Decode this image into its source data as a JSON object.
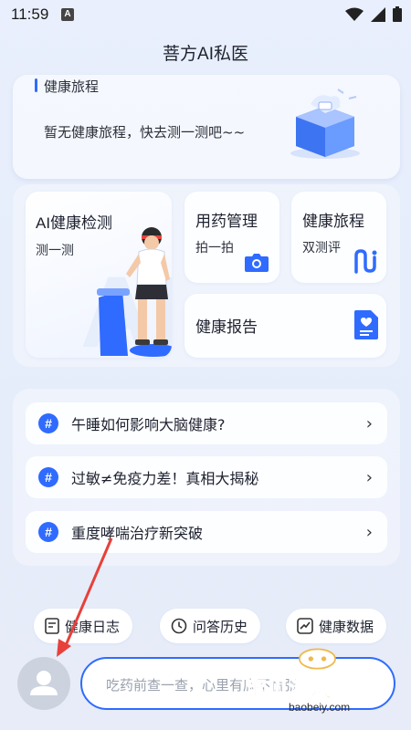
{
  "status_bar": {
    "time": "11:59",
    "notif_letter": "A"
  },
  "header": {
    "title": "菩方AI私医"
  },
  "journey": {
    "title": "健康旅程",
    "empty_text": "暂无健康旅程，快去测一测吧~~"
  },
  "features": {
    "ai_check": {
      "title": "AI健康检测",
      "sub": "测一测"
    },
    "medicine": {
      "title": "用药管理",
      "sub": "拍一拍"
    },
    "journey": {
      "title": "健康旅程",
      "sub": "双测评"
    },
    "report": {
      "title": "健康报告"
    }
  },
  "questions": [
    {
      "text": "午睡如何影响大脑健康?"
    },
    {
      "text": "过敏≠免疫力差！真相大揭秘"
    },
    {
      "text": "重度哮喘治疗新突破"
    }
  ],
  "chips": {
    "diary": "健康日志",
    "history": "问答历史",
    "data": "健康数据"
  },
  "input": {
    "placeholder": "吃药前查一查，心里有底不慌张"
  },
  "watermark": {
    "text": "宝贝游戏网",
    "url": "baobeiy.com"
  },
  "colors": {
    "accent": "#2f6bff",
    "background": "#e8eefb"
  }
}
